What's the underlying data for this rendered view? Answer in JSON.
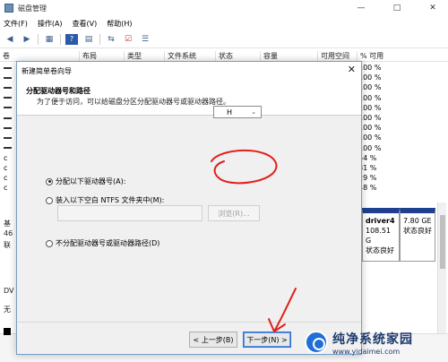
{
  "window": {
    "title": "磁盘管理",
    "controls": [
      "—",
      "□",
      "✕"
    ]
  },
  "menu": [
    "文件(F)",
    "操作(A)",
    "查看(V)",
    "帮助(H)"
  ],
  "table": {
    "columns": [
      "卷",
      "布局",
      "类型",
      "文件系统",
      "状态",
      "容量",
      "可用空间",
      "% 可用"
    ],
    "pct_values": [
      "100 %",
      "100 %",
      "100 %",
      "100 %",
      "100 %",
      "100 %",
      "100 %",
      "100 %",
      "100 %",
      "54 %",
      "81 %",
      "29 %",
      "48 %"
    ],
    "row_markers": [
      "▬",
      "▬",
      "▬",
      "▬",
      "▬",
      "▬",
      "▬",
      "▬",
      "▬",
      "c",
      "c",
      "c",
      "c"
    ]
  },
  "disk_left": {
    "base": "基",
    "size": "46",
    "online": "联",
    "dvd": "DV",
    "none": "无"
  },
  "partitions": [
    {
      "name": "driver4",
      "size": "108.51 G",
      "status": "状态良好"
    },
    {
      "name": "",
      "size": "7.80 GE",
      "status": "状态良好"
    }
  ],
  "wizard": {
    "title": "新建简单卷向导",
    "close": "✕",
    "heading": "分配驱动器号和路径",
    "subheading": "为了便于访问，可以给磁盘分区分配驱动器号或驱动器路径。",
    "option_letter": "分配以下驱动器号(A):",
    "drive_letter": "H",
    "option_folder": "装入以下空白 NTFS 文件夹中(M):",
    "browse": "浏览(R)...",
    "option_none": "不分配驱动器号或驱动器路径(D)",
    "btn_back": "< 上一步(B)",
    "btn_next": "下一步(N) >"
  },
  "watermark": {
    "name": "纯净系统家园",
    "url": "www.yidaimei.com"
  },
  "colors": {
    "annotation": "#e0201a",
    "partition_bar": "#1f3f8f"
  }
}
